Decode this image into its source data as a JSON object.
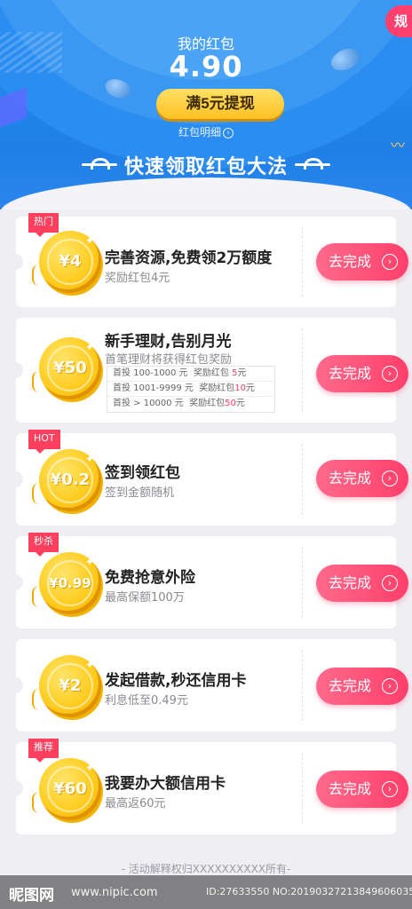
{
  "header": {
    "title": "我的红包",
    "amount": "4.90",
    "withdraw_label": "满5元提现",
    "detail_label": "红包明细",
    "corner_badge": "规",
    "banner": "快速领取红包大法"
  },
  "tasks": [
    {
      "tag": "热门",
      "coin": "¥4",
      "title": "完善资源,免费领2万额度",
      "subtitle": "奖励红包4元",
      "button": "去完成"
    },
    {
      "tag": "",
      "coin": "¥50",
      "title": "新手理财,告别月光",
      "subtitle": "首笔理财将获得红包奖励",
      "button": "去完成",
      "table": [
        {
          "label": "首投  100-1000  元",
          "reward": "奖励红包 ",
          "amount": "5",
          "unit": "元"
        },
        {
          "label": "首投  1001-9999 元",
          "reward": "奖励红包",
          "amount": "10",
          "unit": "元"
        },
        {
          "label": "首投   > 10000  元",
          "reward": "奖励红包",
          "amount": "50",
          "unit": "元"
        }
      ]
    },
    {
      "tag": "HOT",
      "coin": "¥0.2",
      "title": "签到领红包",
      "subtitle": "签到金额随机",
      "button": "去完成"
    },
    {
      "tag": "秒杀",
      "coin": "¥0.99",
      "title": "免费抢意外险",
      "subtitle": "最高保额100万",
      "button": "去完成"
    },
    {
      "tag": "",
      "coin": "¥2",
      "title": "发起借款,秒还信用卡",
      "subtitle": "利息低至0.49元",
      "button": "去完成"
    },
    {
      "tag": "推荐",
      "coin": "¥60",
      "title": "我要办大额信用卡",
      "subtitle": "最高返60元",
      "button": "去完成"
    }
  ],
  "footer": "- 活动解释权归XXXXXXXXXX所有-",
  "watermark": {
    "logo": "昵图网",
    "url": "www.nipic.com",
    "id": "ID:27633550 NO:20190327213849606035"
  },
  "colors": {
    "header_blue": "#2a93ef",
    "button_pink": "#ff3f6b",
    "withdraw_yellow": "#ffc123",
    "tag_red": "#ff3f5e"
  }
}
